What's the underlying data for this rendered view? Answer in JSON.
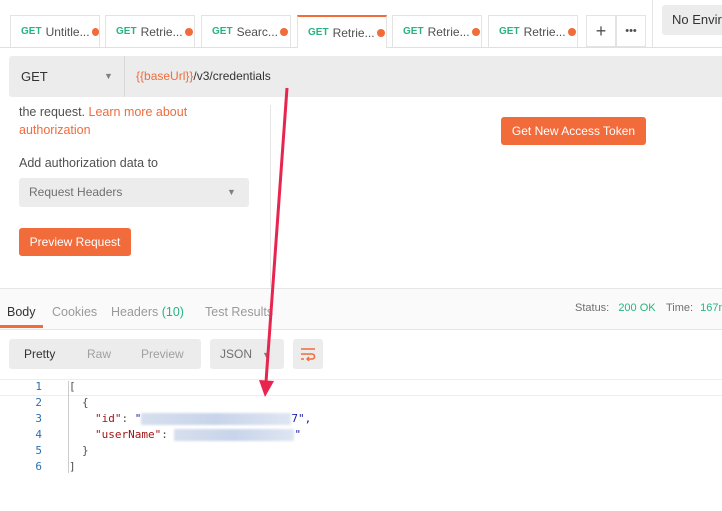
{
  "tabs": [
    {
      "method": "GET",
      "name": "Untitle...",
      "active": false
    },
    {
      "method": "GET",
      "name": "Retrie...",
      "active": false
    },
    {
      "method": "GET",
      "name": "Searc...",
      "active": false
    },
    {
      "method": "GET",
      "name": "Retrie...",
      "active": true
    },
    {
      "method": "GET",
      "name": "Retrie...",
      "active": false
    },
    {
      "method": "GET",
      "name": "Retrie...",
      "active": false
    }
  ],
  "tab_actions": {
    "add": "+",
    "more": "•••"
  },
  "environment": "No Envir",
  "request": {
    "method": "GET",
    "url_var": "{{baseUrl}}",
    "url_path": "/v3/credentials"
  },
  "auth": {
    "text": "the request.",
    "learn_more": "Learn more about",
    "learn_more2": "authorization",
    "add_to_label": "Add authorization data to",
    "add_to_value": "Request Headers",
    "preview_button": "Preview Request",
    "token_button": "Get New Access Token"
  },
  "response": {
    "tabs": [
      "Body",
      "Cookies",
      "Headers",
      "Test Results"
    ],
    "headers_count": "(10)",
    "status_label": "Status:",
    "status_value": "200 OK",
    "time_label": "Time:",
    "time_value": "167m"
  },
  "view": {
    "modes": [
      "Pretty",
      "Raw",
      "Preview"
    ],
    "format": "JSON"
  },
  "code": {
    "line_numbers": [
      "1",
      "2",
      "3",
      "4",
      "5",
      "6"
    ],
    "open_bracket": "[",
    "open_brace": "{",
    "id_key": "\"id\"",
    "id_suffix": "7\",",
    "username_key": "\"userName\"",
    "username_suffix": "\"",
    "close_brace": "}",
    "close_bracket": "]"
  },
  "colors": {
    "accent": "#f26b3a",
    "success": "#26b47f",
    "arrow": "#e8254f"
  }
}
